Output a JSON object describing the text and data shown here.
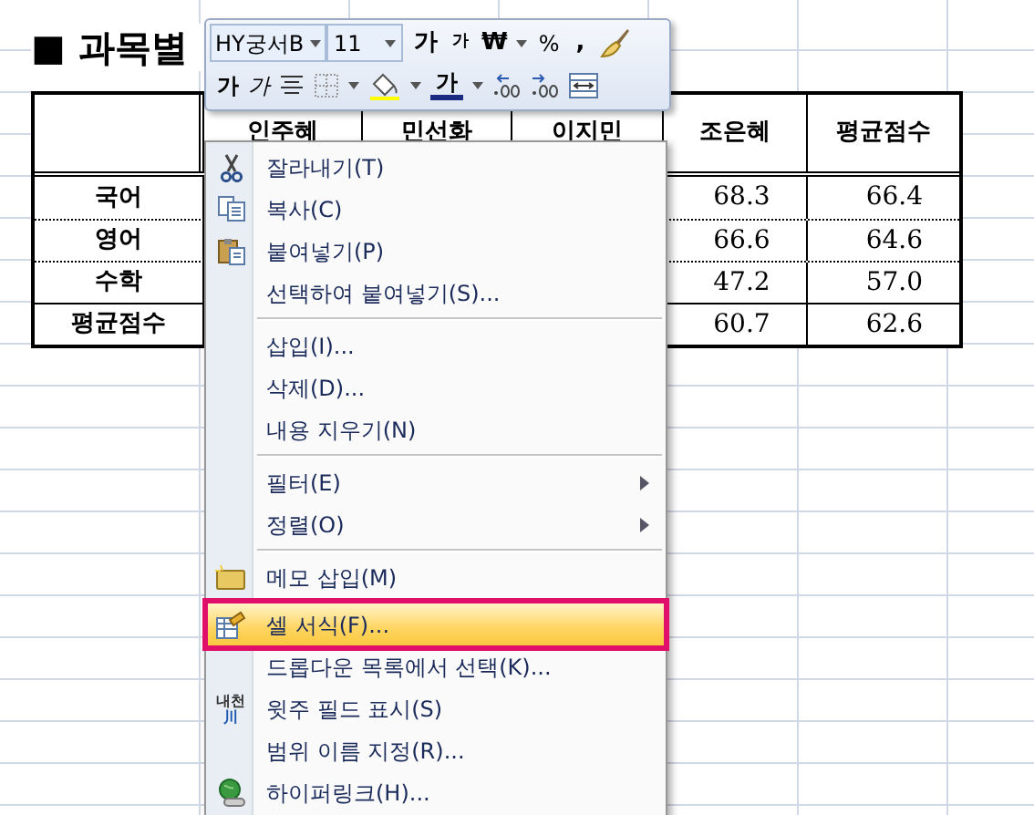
{
  "sheet": {
    "title": "■ 과목별",
    "table": {
      "columns": [
        "",
        "인주혜",
        "민선화",
        "이지민",
        "조은혜",
        "평균점수"
      ],
      "rows": [
        {
          "cells": [
            "국어",
            "",
            "",
            "",
            "68.3",
            "66.4"
          ],
          "total": false
        },
        {
          "cells": [
            "영어",
            "",
            "",
            "",
            "66.6",
            "64.6"
          ],
          "total": false
        },
        {
          "cells": [
            "수학",
            "",
            "",
            "",
            "47.2",
            "57.0"
          ],
          "total": false
        },
        {
          "cells": [
            "평균점수",
            "",
            "",
            "",
            "60.7",
            "62.6"
          ],
          "total": true
        }
      ]
    }
  },
  "mini_toolbar": {
    "font": "HY궁서B",
    "size": "11",
    "grow": "가",
    "shrink": "가",
    "currency": "₩",
    "percent": "%",
    "comma": ",",
    "bold": "가",
    "italic": "가",
    "font_color": "가"
  },
  "context_menu": {
    "items": [
      {
        "label": "잘라내기(T)",
        "kind": "cut",
        "submenu": false,
        "selected": false
      },
      {
        "label": "복사(C)",
        "kind": "copy",
        "submenu": false,
        "selected": false
      },
      {
        "label": "붙여넣기(P)",
        "kind": "paste",
        "submenu": false,
        "selected": false
      },
      {
        "label": "선택하여 붙여넣기(S)...",
        "kind": "plain",
        "submenu": false,
        "selected": false
      },
      {
        "kind": "separator"
      },
      {
        "label": "삽입(I)...",
        "kind": "plain",
        "submenu": false,
        "selected": false
      },
      {
        "label": "삭제(D)...",
        "kind": "plain",
        "submenu": false,
        "selected": false
      },
      {
        "label": "내용 지우기(N)",
        "kind": "plain",
        "submenu": false,
        "selected": false
      },
      {
        "kind": "separator"
      },
      {
        "label": "필터(E)",
        "kind": "plain",
        "submenu": true,
        "selected": false
      },
      {
        "label": "정렬(O)",
        "kind": "plain",
        "submenu": true,
        "selected": false
      },
      {
        "kind": "separator"
      },
      {
        "label": "메모 삽입(M)",
        "kind": "note",
        "submenu": false,
        "selected": false
      },
      {
        "label": "셀 서식(F)...",
        "kind": "format",
        "submenu": false,
        "selected": true
      },
      {
        "label": "드롭다운 목록에서 선택(K)...",
        "kind": "plain",
        "submenu": false,
        "selected": false
      },
      {
        "label": "윗주 필드 표시(S)",
        "kind": "phonetic",
        "icon_text": [
          "내천",
          "川"
        ],
        "submenu": false,
        "selected": false
      },
      {
        "label": "범위 이름 지정(R)...",
        "kind": "plain",
        "submenu": false,
        "selected": false
      },
      {
        "label": "하이퍼링크(H)...",
        "kind": "link",
        "submenu": false,
        "selected": false
      }
    ]
  }
}
